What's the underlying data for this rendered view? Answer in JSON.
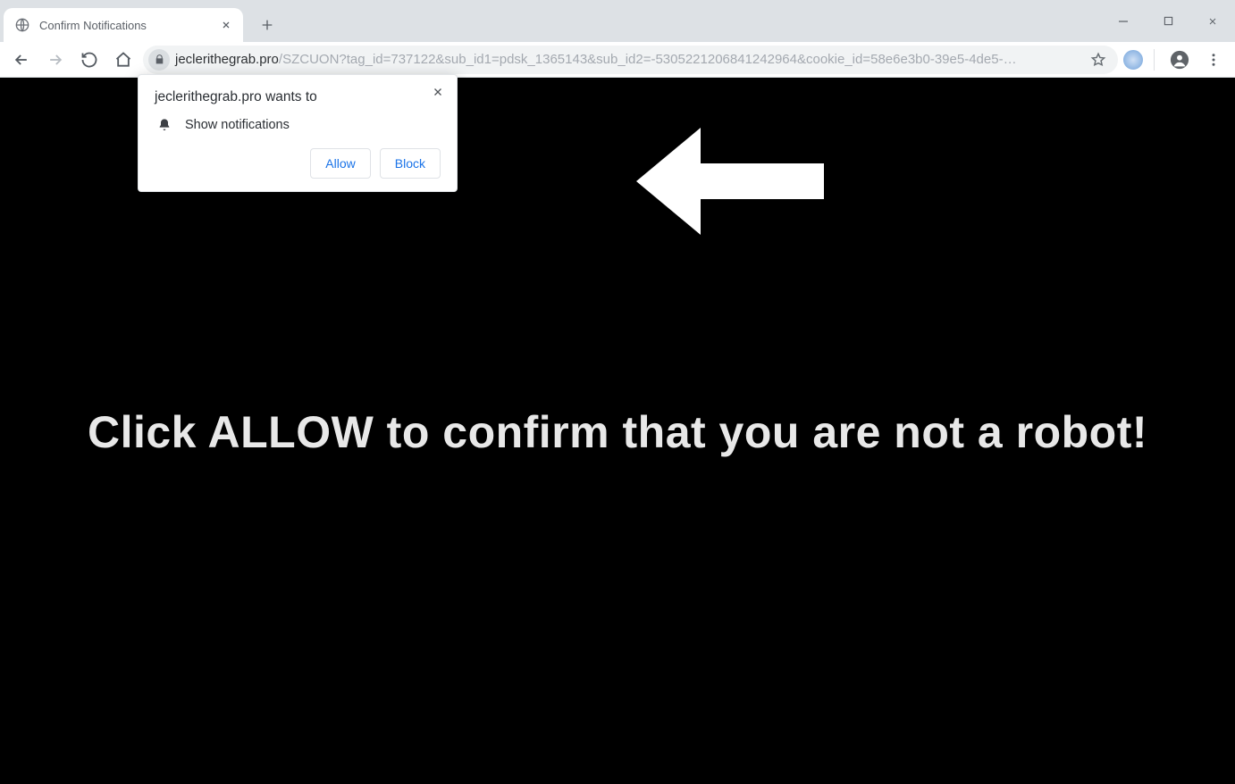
{
  "window": {
    "tab_title": "Confirm Notifications"
  },
  "address": {
    "host": "jeclerithegrab.pro",
    "path_display": "/SZCUON?tag_id=737122&sub_id1=pdsk_1365143&sub_id2=-5305221206841242964&cookie_id=58e6e3b0-39e5-4de5-…"
  },
  "permission_prompt": {
    "title": "jeclerithegrab.pro wants to",
    "capability": "Show notifications",
    "allow_label": "Allow",
    "block_label": "Block"
  },
  "page": {
    "instruction_text": "Click ALLOW to confirm that you are not a robot!"
  }
}
